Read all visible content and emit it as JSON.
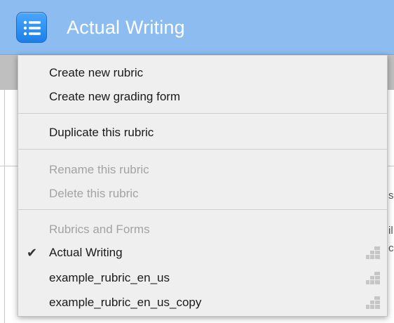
{
  "app": {
    "title": "Actual Writing",
    "menu_icon": "list-menu-icon"
  },
  "menu": {
    "group_create": [
      {
        "label": "Create new rubric"
      },
      {
        "label": "Create new grading form"
      }
    ],
    "group_duplicate": [
      {
        "label": "Duplicate this rubric"
      }
    ],
    "group_disabled": [
      {
        "label": "Rename this rubric"
      },
      {
        "label": "Delete this rubric"
      }
    ],
    "section_label": "Rubrics and Forms",
    "rubrics": [
      {
        "label": "Actual Writing",
        "checked": true,
        "icon": "grid-icon"
      },
      {
        "label": "example_rubric_en_us",
        "checked": false,
        "icon": "grid-icon"
      },
      {
        "label": "example_rubric_en_us_copy",
        "checked": false,
        "icon": "grid-icon"
      }
    ],
    "check_glyph": "✔"
  },
  "colors": {
    "header": "#8cbcf0",
    "accent": "#2a8af0",
    "menu_bg": "#efefef",
    "disabled_text": "#a3a3a3"
  }
}
